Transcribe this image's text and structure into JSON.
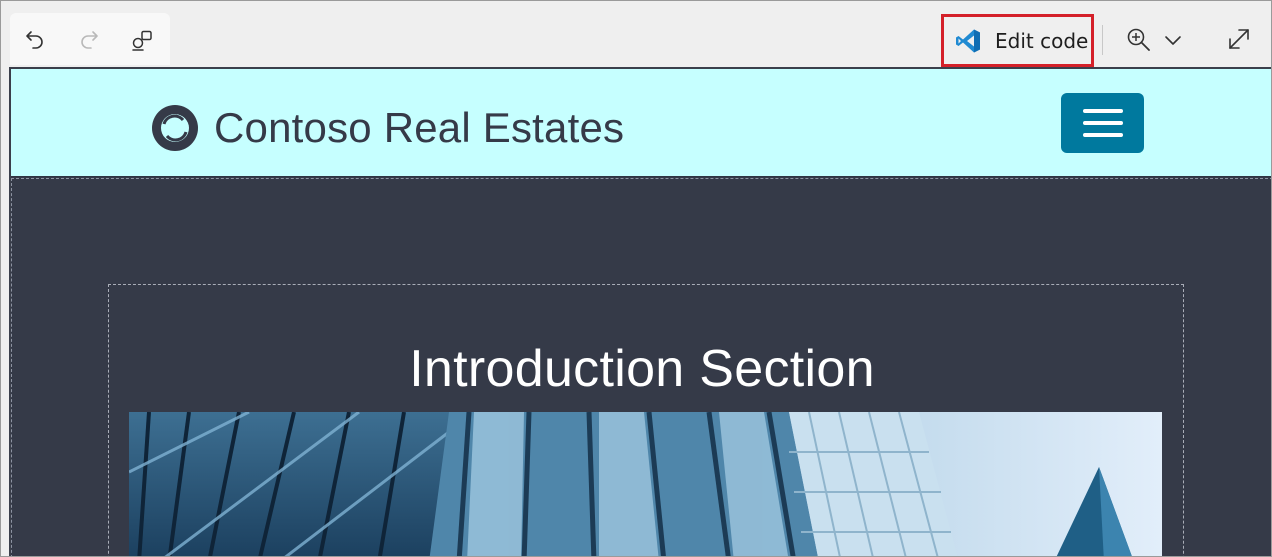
{
  "toolbar": {
    "undo_icon": "undo-icon",
    "redo_icon": "redo-icon",
    "shapes_icon": "shapes-icon",
    "edit_code_label": "Edit code",
    "edit_code_icon": "vscode-icon",
    "zoom_icon": "zoom-in-icon",
    "dropdown_icon": "chevron-down-icon",
    "expand_icon": "expand-icon",
    "highlight_color": "#d42029"
  },
  "site": {
    "title": "Contoso Real Estates",
    "logo_icon": "ring-logo-icon",
    "menu_icon": "hamburger-menu-icon",
    "header_bg": "#c6ffff",
    "accent": "#00799e",
    "body_bg": "#353a48"
  },
  "intro": {
    "heading": "Introduction Section",
    "image": "building-facade-photo"
  }
}
